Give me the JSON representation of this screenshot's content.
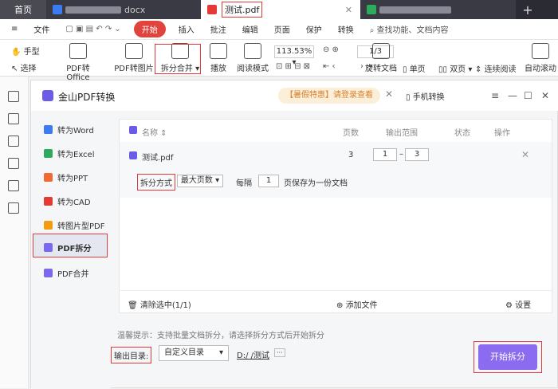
{
  "tabs": {
    "home": "首页",
    "docx": "docx",
    "pdf": "测试.pdf",
    "plus": "+"
  },
  "menu": {
    "file": "文件",
    "start": "开始",
    "insert": "插入",
    "annotate": "批注",
    "edit": "编辑",
    "page": "页面",
    "protect": "保护",
    "convert": "转换",
    "search": "查找功能、文档内容"
  },
  "ribbon": {
    "hand": "手型",
    "select": "选择",
    "pdf_office": "PDF转Office",
    "pdf_image": "PDF转图片",
    "split_merge": "拆分合并",
    "play": "播放",
    "read_mode": "阅读模式",
    "zoom": "113.53%",
    "page": "1/3",
    "rotate": "旋转文档",
    "single": "单页",
    "double": "双页",
    "continuous": "连续阅读",
    "auto_scroll": "自动滚动"
  },
  "dialog": {
    "title": "金山PDF转换",
    "promo": "【暑假特惠】请登录查看",
    "mobile": "手机转换"
  },
  "side_items": [
    {
      "label": "转为Word",
      "color": "#3d7bf2"
    },
    {
      "label": "转为Excel",
      "color": "#2daa5c"
    },
    {
      "label": "转为PPT",
      "color": "#f06a35"
    },
    {
      "label": "转为CAD",
      "color": "#e53935"
    },
    {
      "label": "转图片型PDF",
      "color": "#f39c12"
    },
    {
      "label": "PDF拆分",
      "color": "#7b68ee"
    },
    {
      "label": "PDF合并",
      "color": "#7b68ee"
    }
  ],
  "table": {
    "name": "名称",
    "pages": "页数",
    "range": "输出范围",
    "status": "状态",
    "action": "操作"
  },
  "file": {
    "name": "测试.pdf",
    "pages": "3",
    "from": "1",
    "dash": "–",
    "to": "3"
  },
  "split": {
    "method_label": "拆分方式",
    "method_value": "最大页数",
    "every": "每隔",
    "n": "1",
    "suffix": "页保存为一份文档"
  },
  "footer": {
    "clear": "清除选中(1/1)",
    "add": "添加文件",
    "settings": "设置"
  },
  "hint": "温馨提示：支持批量文档拆分，请选择拆分方式后开始拆分",
  "output": {
    "label": "输出目录:",
    "select": "自定义目录",
    "path": "D:/   /测试",
    "more": "···"
  },
  "start_split": "开始拆分"
}
